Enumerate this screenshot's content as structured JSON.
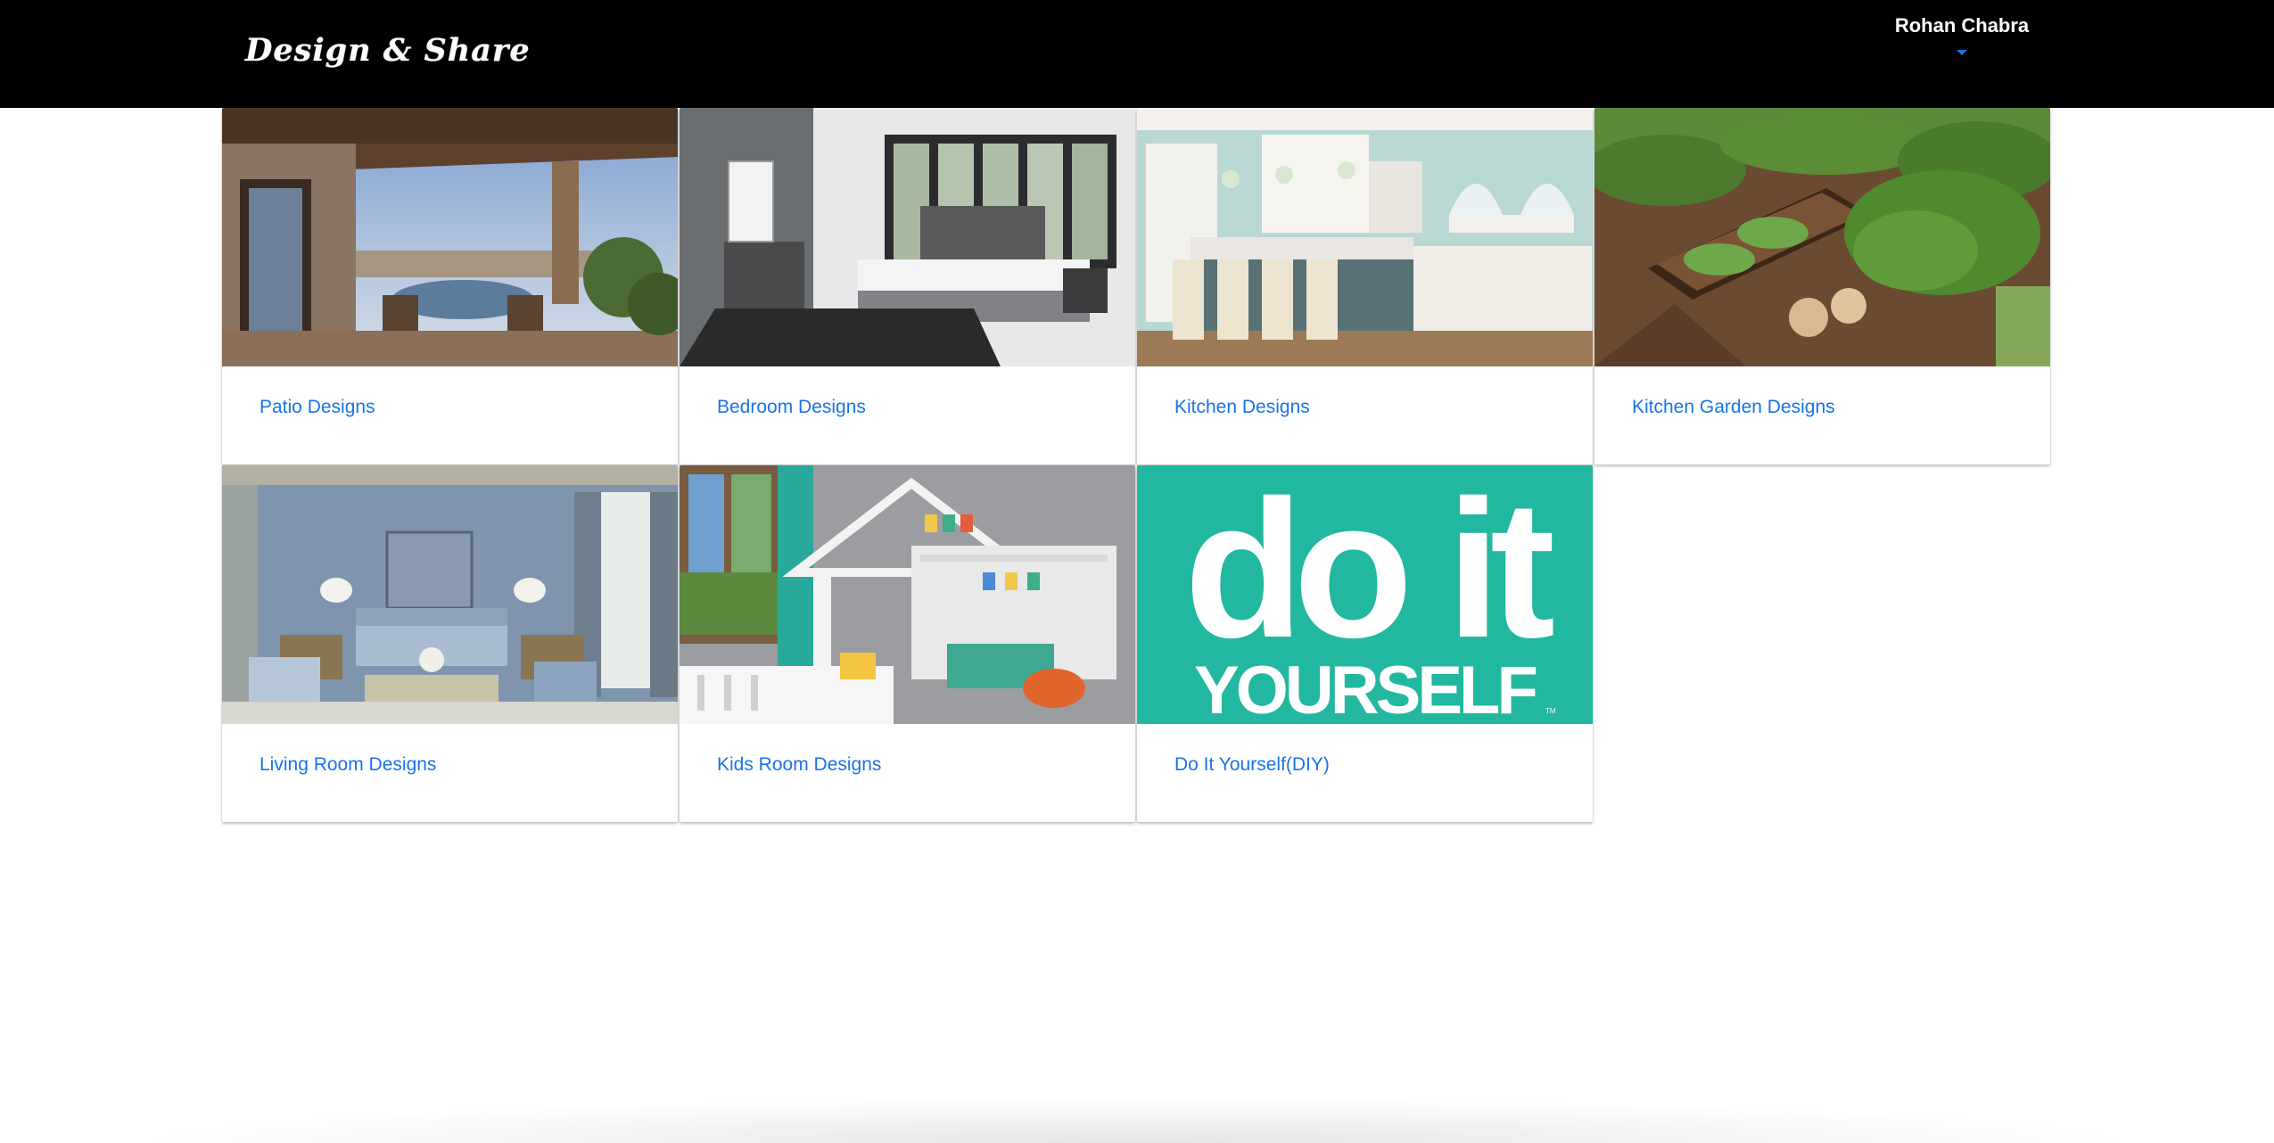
{
  "navbar": {
    "brand": "Design & Share",
    "user_name": "Rohan Chabra"
  },
  "categories": [
    {
      "label": "Patio Designs"
    },
    {
      "label": "Bedroom Designs"
    },
    {
      "label": "Kitchen Designs"
    },
    {
      "label": "Kitchen Garden Designs"
    },
    {
      "label": "Living Room Designs"
    },
    {
      "label": "Kids Room Designs"
    },
    {
      "label": "Do It Yourself(DIY)"
    }
  ],
  "diy_image": {
    "line1": "do it",
    "line2": "YOURSELF",
    "tm": "TM",
    "bg_color": "#22b8a0"
  },
  "colors": {
    "link": "#1a73e8",
    "navbar": "#000000"
  }
}
